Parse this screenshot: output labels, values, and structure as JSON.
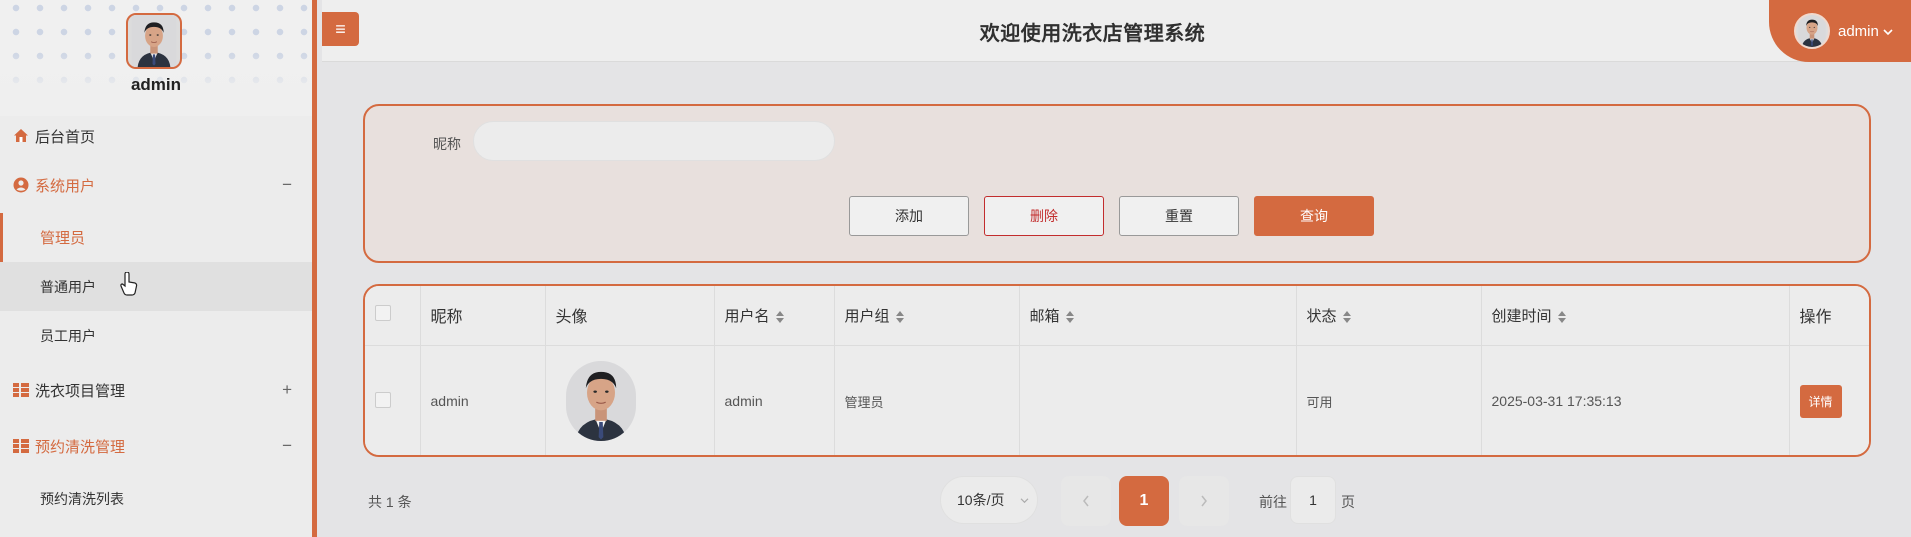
{
  "sidebar": {
    "user_name": "admin",
    "menu": [
      {
        "label": "后台首页",
        "icon": "home-icon"
      },
      {
        "label": "系统用户",
        "icon": "user-circle-icon",
        "toggle": "−"
      },
      {
        "label": "洗衣项目管理",
        "icon": "grid-icon",
        "toggle": "+"
      },
      {
        "label": "预约清洗管理",
        "icon": "grid-icon",
        "toggle": "−"
      }
    ],
    "sub_items": [
      "管理员",
      "普通用户",
      "员工用户",
      "预约清洗列表"
    ]
  },
  "header": {
    "title": "欢迎使用洗衣店管理系统",
    "menu_icon": "≡",
    "user": "admin"
  },
  "search": {
    "nick_label": "昵称",
    "nick_value": "",
    "buttons": {
      "add": "添加",
      "delete": "删除",
      "reset": "重置",
      "query": "查询"
    }
  },
  "table": {
    "headers": [
      "昵称",
      "头像",
      "用户名",
      "用户组",
      "邮箱",
      "状态",
      "创建时间",
      "操作"
    ],
    "rows": [
      {
        "nickname": "admin",
        "username": "admin",
        "group": "管理员",
        "email": "",
        "status": "可用",
        "created": "2025-03-31 17:35:13",
        "action": "详情"
      }
    ]
  },
  "pagination": {
    "total": "共 1 条",
    "page_size": "10条/页",
    "current": "1",
    "goto_prefix": "前往",
    "goto_value": "1",
    "goto_suffix": "页"
  },
  "colors": {
    "accent": "#d46a40",
    "danger": "#c22d2d"
  }
}
